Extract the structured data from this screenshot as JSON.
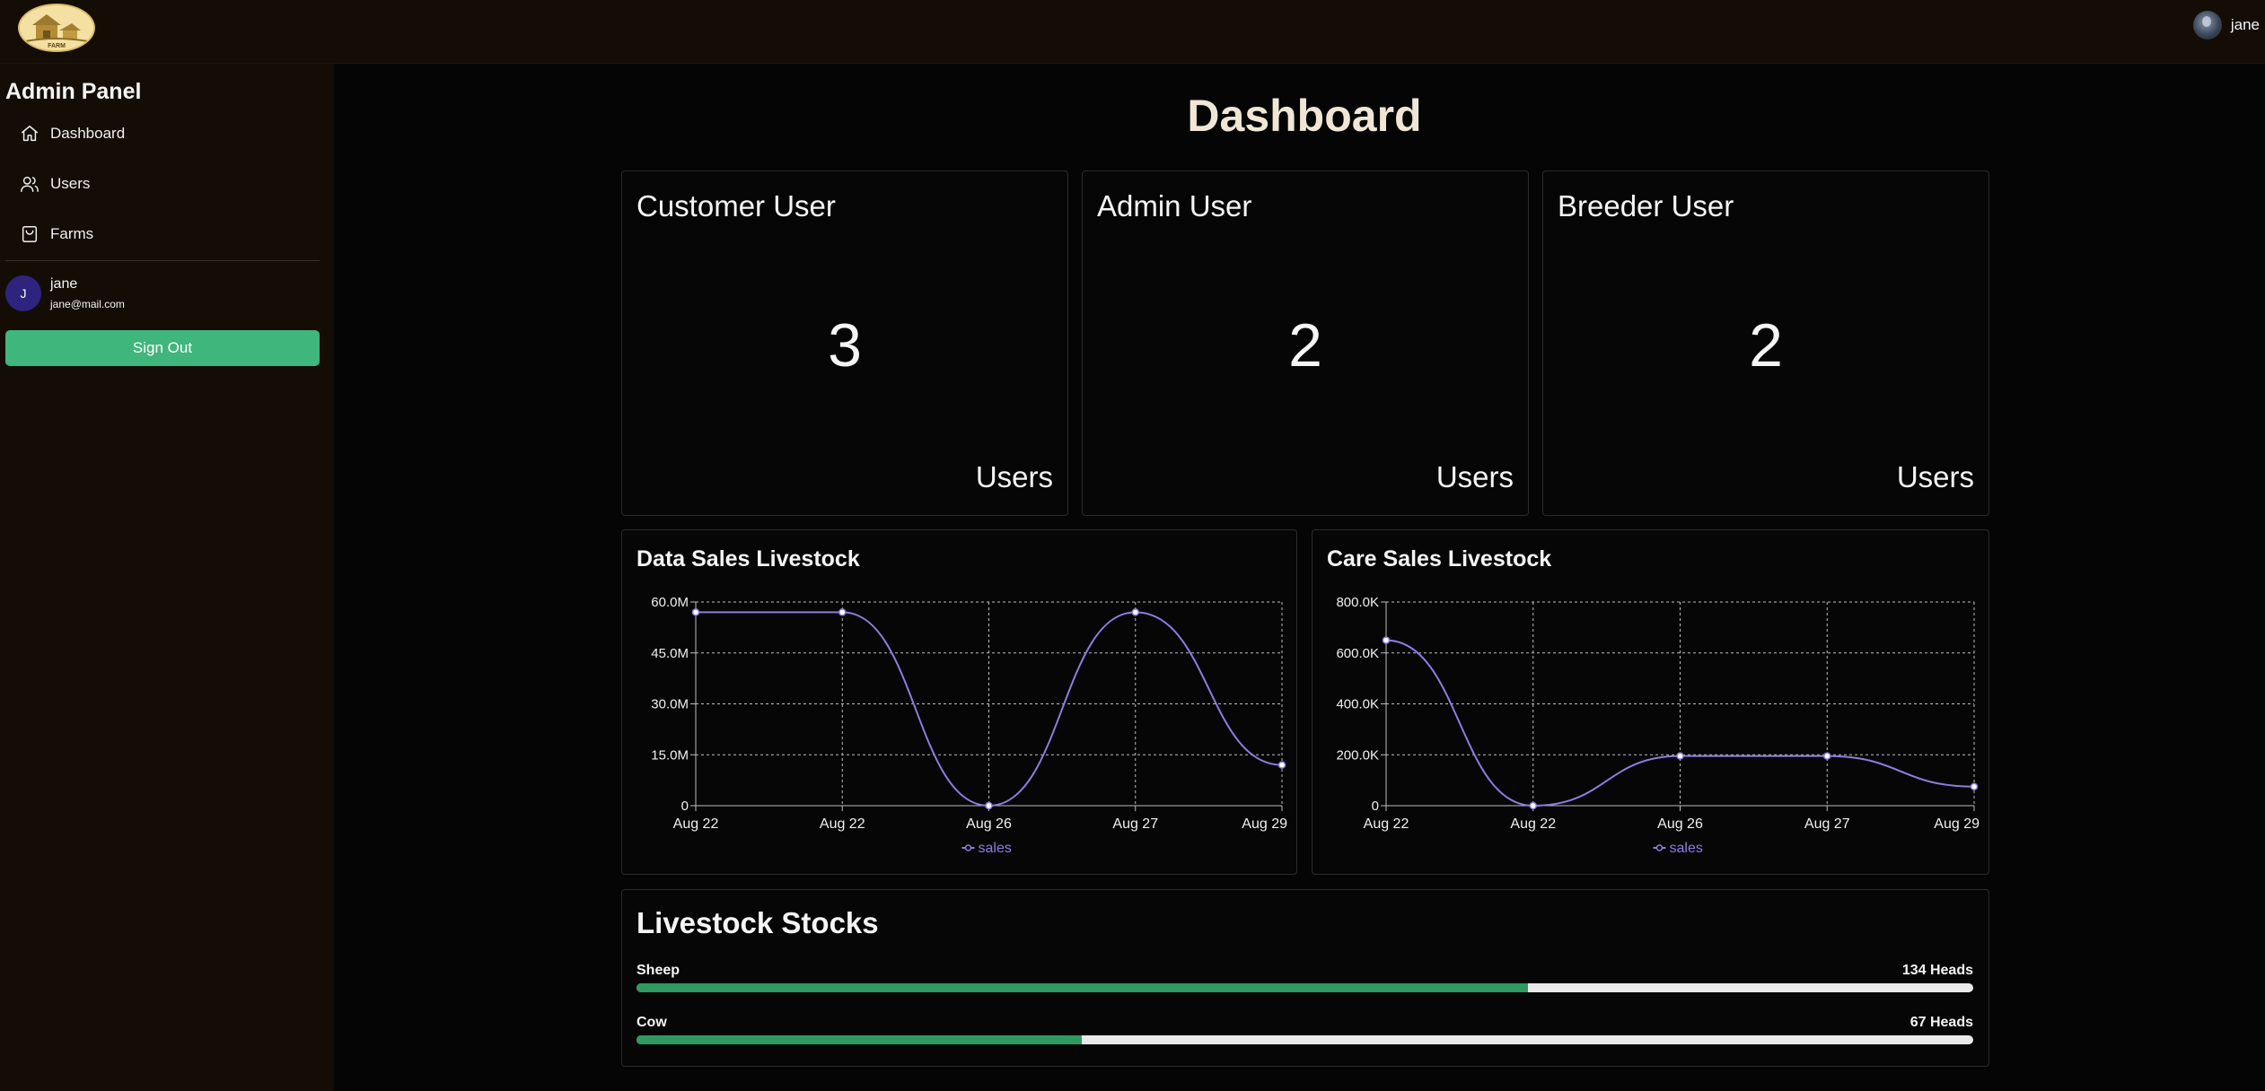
{
  "header": {
    "logo_text": "FARM",
    "user_name": "jane"
  },
  "sidebar": {
    "title": "Admin Panel",
    "items": [
      {
        "label": "Dashboard",
        "icon": "home-icon"
      },
      {
        "label": "Users",
        "icon": "users-icon"
      },
      {
        "label": "Farms",
        "icon": "shopping-bag-icon"
      }
    ],
    "profile": {
      "initial": "J",
      "name": "jane",
      "email": "jane@mail.com"
    },
    "signout_label": "Sign Out"
  },
  "main": {
    "title": "Dashboard",
    "stats": [
      {
        "title": "Customer User",
        "value": "3",
        "unit": "Users"
      },
      {
        "title": "Admin User",
        "value": "2",
        "unit": "Users"
      },
      {
        "title": "Breeder User",
        "value": "2",
        "unit": "Users"
      }
    ],
    "stocks": {
      "title": "Livestock Stocks",
      "items": [
        {
          "label": "Sheep",
          "count": "134 Heads",
          "fraction": 0.667
        },
        {
          "label": "Cow",
          "count": "67 Heads",
          "fraction": 0.333
        }
      ]
    }
  },
  "colors": {
    "line": "#8c7ee0",
    "grid": "#bdbdbd",
    "progress": "#2f9a5f",
    "signout": "#3fb67b"
  },
  "chart_data": [
    {
      "type": "line",
      "title": "Data Sales Livestock",
      "categories": [
        "Aug 22",
        "Aug 22",
        "Aug 26",
        "Aug 27",
        "Aug 29"
      ],
      "series": [
        {
          "name": "sales",
          "values": [
            57000000,
            57000000,
            0,
            57000000,
            12000000
          ]
        }
      ],
      "yticks": [
        0,
        15000000,
        30000000,
        45000000,
        60000000
      ],
      "ytick_labels": [
        "0",
        "15.0M",
        "30.0M",
        "45.0M",
        "60.0M"
      ],
      "ylim": [
        0,
        60000000
      ],
      "grid": true,
      "legend": "bottom"
    },
    {
      "type": "line",
      "title": "Care Sales Livestock",
      "categories": [
        "Aug 22",
        "Aug 22",
        "Aug 26",
        "Aug 27",
        "Aug 29"
      ],
      "series": [
        {
          "name": "sales",
          "values": [
            650000,
            0,
            195000,
            195000,
            75000
          ]
        }
      ],
      "yticks": [
        0,
        200000,
        400000,
        600000,
        800000
      ],
      "ytick_labels": [
        "0",
        "200.0K",
        "400.0K",
        "600.0K",
        "800.0K"
      ],
      "ylim": [
        0,
        800000
      ],
      "grid": true,
      "legend": "bottom"
    }
  ]
}
